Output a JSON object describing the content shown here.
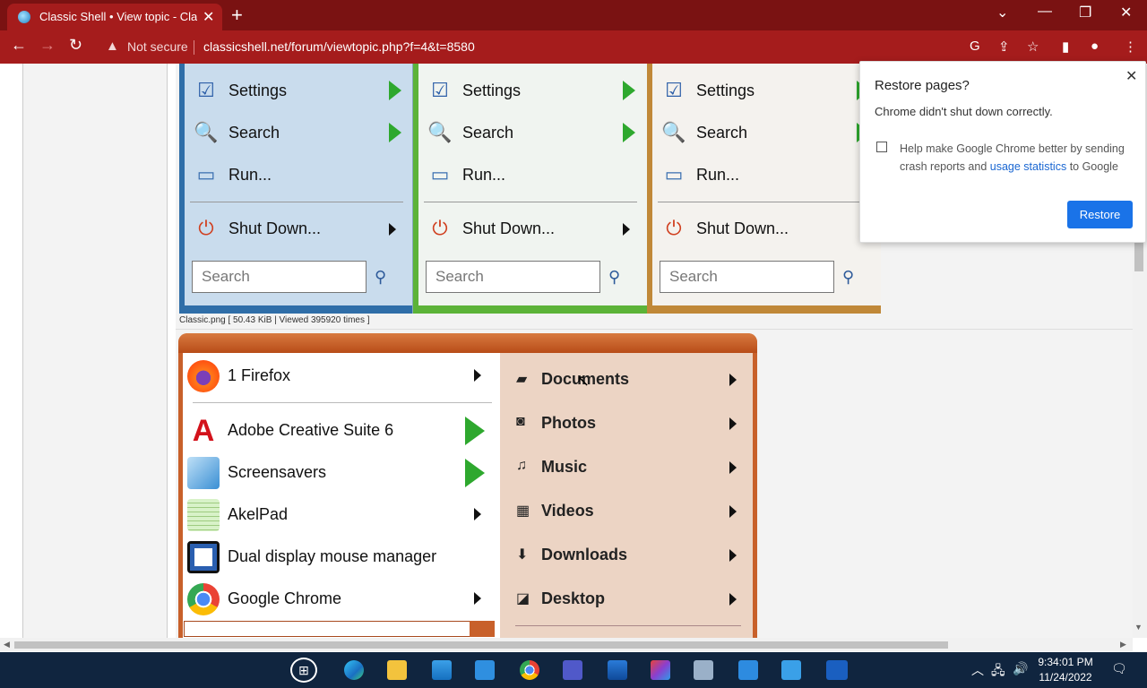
{
  "browser": {
    "tab_title": "Classic Shell • View topic - Classic",
    "security_label": "Not secure",
    "url": "classicshell.net/forum/viewtopic.php?f=4&t=8580"
  },
  "classic_menus": [
    {
      "items": [
        "Settings",
        "Search",
        "Run...",
        "Shut Down..."
      ],
      "search_placeholder": "Search"
    },
    {
      "items": [
        "Settings",
        "Search",
        "Run...",
        "Shut Down..."
      ],
      "search_placeholder": "Search"
    },
    {
      "items": [
        "Settings",
        "Search",
        "Run...",
        "Shut Down..."
      ],
      "search_placeholder": "Search"
    }
  ],
  "attachment_caption": "Classic.png [ 50.43 KiB | Viewed 395920 times ]",
  "start_menu": {
    "left_items": [
      {
        "label": "1 Firefox"
      },
      {
        "label": "Adobe Creative Suite 6"
      },
      {
        "label": "Screensavers"
      },
      {
        "label": "AkelPad"
      },
      {
        "label": "Dual display mouse manager"
      },
      {
        "label": "Google Chrome"
      }
    ],
    "right_items": [
      {
        "label": "Documents"
      },
      {
        "label": "Photos"
      },
      {
        "label": "Music"
      },
      {
        "label": "Videos"
      },
      {
        "label": "Downloads"
      },
      {
        "label": "Desktop"
      }
    ]
  },
  "restore_dialog": {
    "title": "Restore pages?",
    "message": "Chrome didn't shut down correctly.",
    "help_prefix": "Help make Google Chrome better by sending crash reports and ",
    "help_link": "usage statistics",
    "help_suffix": " to Google",
    "button": "Restore"
  },
  "taskbar": {
    "time": "9:34:01 PM",
    "date": "11/24/2022"
  },
  "colors": {
    "chrome_frame": "#7a1212",
    "chrome_toolbar": "#a51c1c",
    "accent_blue": "#1a73e8"
  }
}
